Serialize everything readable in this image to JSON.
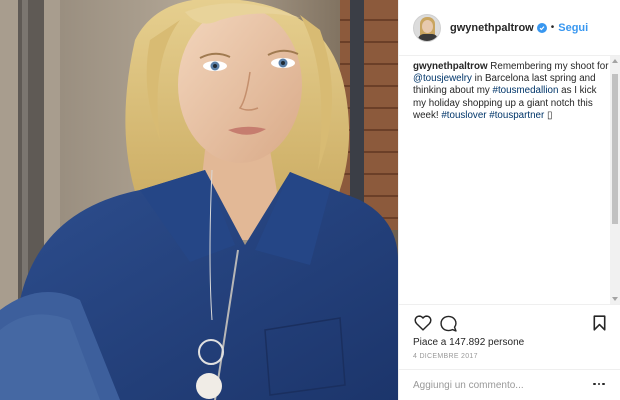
{
  "header": {
    "username": "gwynethpaltrow",
    "separator": "•",
    "follow_label": "Segui"
  },
  "caption": {
    "username": "gwynethpaltrow",
    "text_1": " Remembering my shoot for ",
    "mention": "@tousjewelry",
    "text_2": " in Barcelona last spring and thinking about my ",
    "hashtag_1": "#tousmedallion",
    "text_3": " as I kick my holiday shopping up a giant notch this week! ",
    "hashtag_2": "#touslover",
    "text_4": " ",
    "hashtag_3": "#touspartner",
    "text_5": " ▯"
  },
  "engagement": {
    "likes": "Piace a 147.892 persone",
    "date": "4 DICEMBRE 2017"
  },
  "comment": {
    "placeholder": "Aggiungi un commento..."
  },
  "icons": {
    "like": "heart-icon",
    "comment": "speech-bubble-icon",
    "save": "bookmark-icon",
    "more": "more-options-icon",
    "verified": "verified-badge-icon"
  },
  "colors": {
    "link_blue": "#3897f0",
    "hashtag_navy": "#003569",
    "muted": "#999999",
    "text": "#262626"
  }
}
